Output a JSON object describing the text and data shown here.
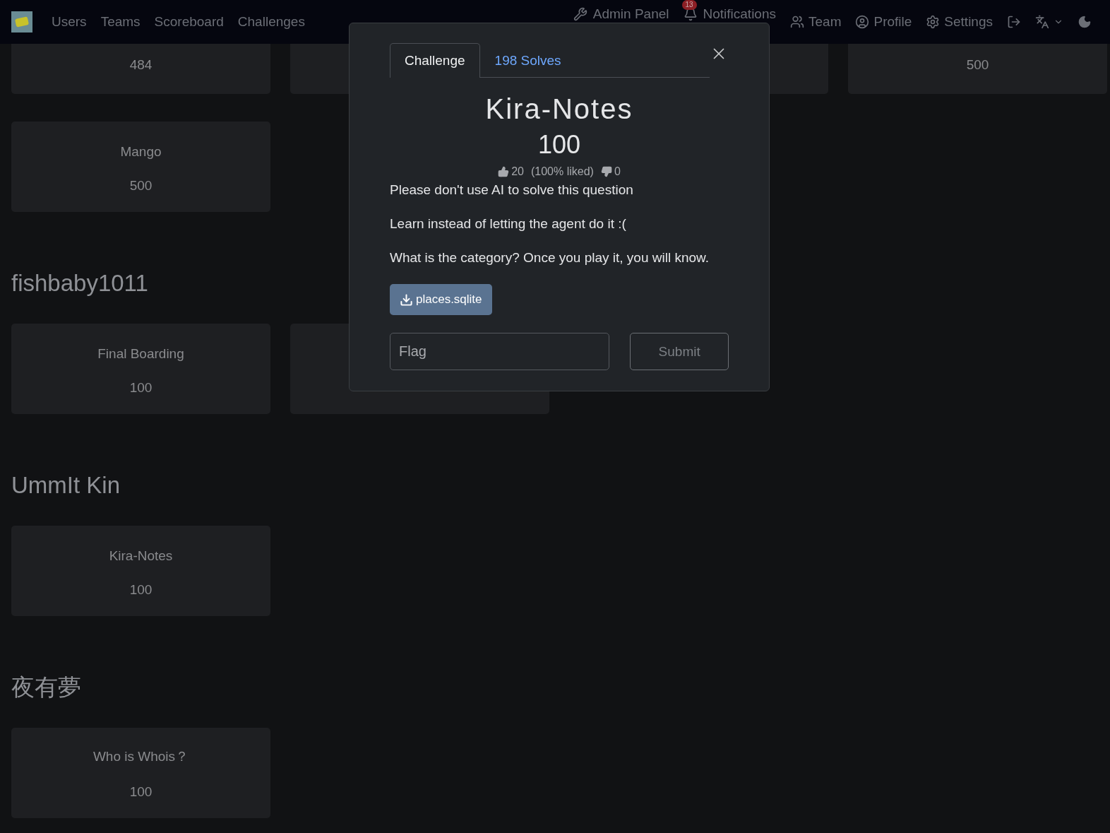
{
  "navbar": {
    "menu": [
      "Users",
      "Teams",
      "Scoreboard",
      "Challenges"
    ],
    "right_items": [
      {
        "kind": "admin",
        "label": "Admin Panel"
      },
      {
        "kind": "notifications",
        "label": "Notifications",
        "badge": "13"
      },
      {
        "kind": "team",
        "label": "Team"
      },
      {
        "kind": "profile",
        "label": "Profile"
      },
      {
        "kind": "settings",
        "label": "Settings"
      },
      {
        "kind": "logout"
      },
      {
        "kind": "language"
      },
      {
        "kind": "theme"
      }
    ]
  },
  "sections": [
    {
      "rows": [
        [
          {
            "points": "484"
          },
          {},
          {},
          {
            "points": "500"
          }
        ],
        [
          {
            "name": "Mango",
            "points": "500"
          }
        ]
      ]
    },
    {
      "title": "fishbaby1011",
      "rows": [
        [
          {
            "name": "Final Boarding",
            "points": "100"
          },
          {}
        ]
      ]
    },
    {
      "title": "UmmIt Kin",
      "rows": [
        [
          {
            "name": "Kira-Notes",
            "points": "100"
          }
        ]
      ]
    },
    {
      "title": "夜有夢",
      "rows": [
        [
          {
            "name": "Who is Whois？",
            "points": "100"
          }
        ]
      ]
    }
  ],
  "modal": {
    "tabs": [
      {
        "label": "Challenge",
        "selected": true
      },
      {
        "label": "198 Solves",
        "selected": false
      }
    ],
    "title": "Kira-Notes",
    "points": "100",
    "votes": {
      "likes": "20",
      "liked": "(100% liked)",
      "dislikes": "0"
    },
    "description": [
      "Please don't use AI to solve this question",
      "Learn instead of letting the agent do it :(",
      "What is the category? Once you play it, you will know."
    ],
    "files": [
      "places.sqlite"
    ],
    "flag": {
      "placeholder": "Flag"
    },
    "submit": "Submit"
  }
}
